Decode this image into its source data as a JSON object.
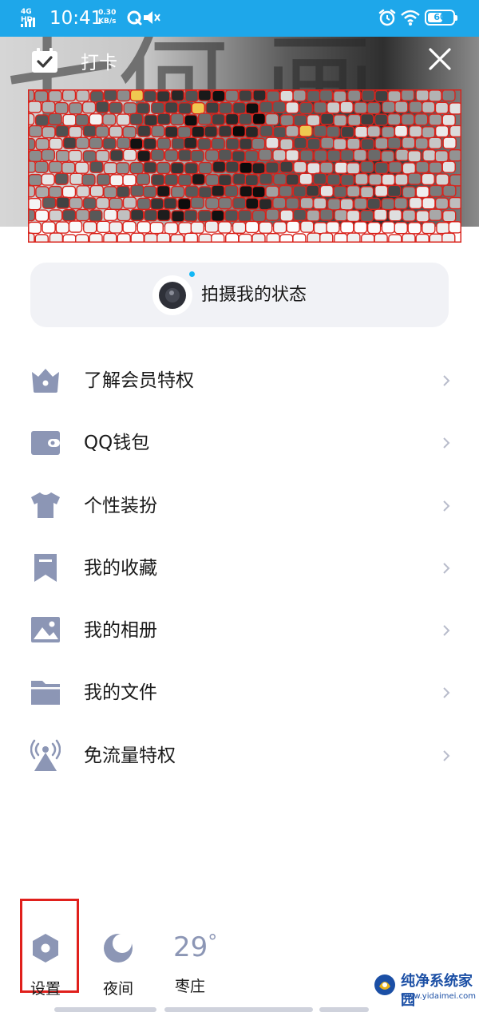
{
  "status_bar": {
    "network": "4G HD",
    "time": "10:41",
    "speed_value": "0.30",
    "speed_unit": "KB/s",
    "battery": "60",
    "battery_level": 0.6
  },
  "header": {
    "checkin_label": "打卡",
    "background_text": "七何 画"
  },
  "shoot": {
    "label": "拍摄我的状态"
  },
  "menu": {
    "items": [
      {
        "label": "了解会员特权",
        "icon": "vip-crown-icon"
      },
      {
        "label": "QQ钱包",
        "icon": "wallet-icon"
      },
      {
        "label": "个性装扮",
        "icon": "tshirt-icon"
      },
      {
        "label": "我的收藏",
        "icon": "bookmark-icon"
      },
      {
        "label": "我的相册",
        "icon": "photo-album-icon"
      },
      {
        "label": "我的文件",
        "icon": "folder-icon"
      },
      {
        "label": "免流量特权",
        "icon": "signal-tower-icon"
      }
    ]
  },
  "bottom": {
    "settings_label": "设置",
    "night_label": "夜间",
    "temperature": "29",
    "temperature_unit": "°",
    "city": "枣庄"
  },
  "watermark": {
    "name": "纯净系统家园",
    "url": "www.yidaimei.com"
  },
  "colors": {
    "status_bar": "#1ea7ea",
    "icon_gray": "#8c96b5",
    "highlight_red": "#e0201c",
    "notify_dot": "#12b7f5"
  }
}
